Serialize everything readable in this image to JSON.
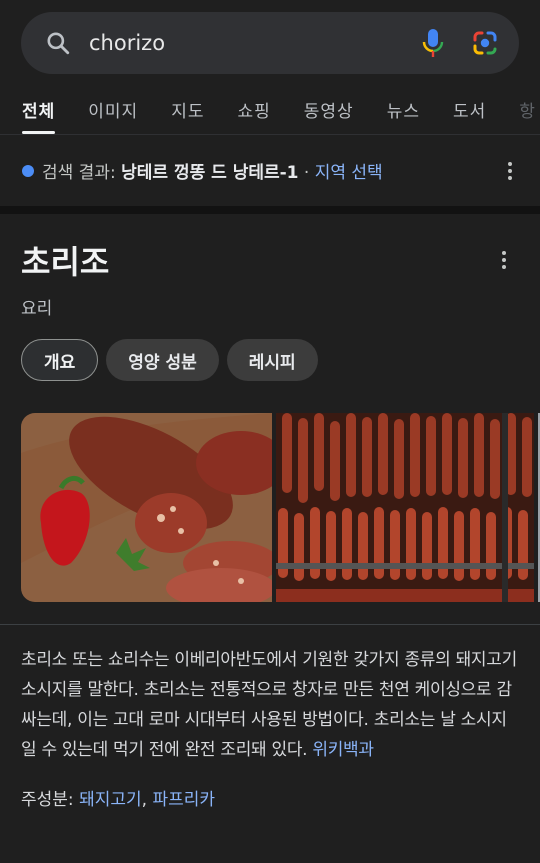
{
  "search": {
    "query": "chorizo"
  },
  "tabs": [
    "전체",
    "이미지",
    "지도",
    "쇼핑",
    "동영상",
    "뉴스",
    "도서",
    "항"
  ],
  "location": {
    "prefix": "검색 결과: ",
    "place": "낭테르 껑똥 드 낭테르-1",
    "separator": " · ",
    "link": "지역 선택"
  },
  "knowledge_panel": {
    "title": "초리조",
    "subtitle": "요리",
    "chips": [
      "개요",
      "영양 성분",
      "레시피"
    ],
    "description": "초리소 또는 쇼리수는 이베리아반도에서 기원한 갖가지 종류의 돼지고기 소시지를 말한다. 초리소는 전통적으로 창자로 만든 천연 케이싱으로 감싸는데, 이는 고대 로마 시대부터 사용된 방법이다. 초리소는 날 소시지일 수 있는데 먹기 전에 완전 조리돼 있다. ",
    "source_link": "위키백과",
    "ingredients_label": "주성분: ",
    "ingredients": [
      "돼지고기",
      "파프리카"
    ],
    "ingredients_separator": ", "
  },
  "colors": {
    "accent_link": "#8ab4f8",
    "location_dot": "#4c8df6",
    "background": "#1f1f1f"
  },
  "icons": [
    "search-icon",
    "microphone-icon",
    "google-lens-icon",
    "more-options-icon"
  ]
}
